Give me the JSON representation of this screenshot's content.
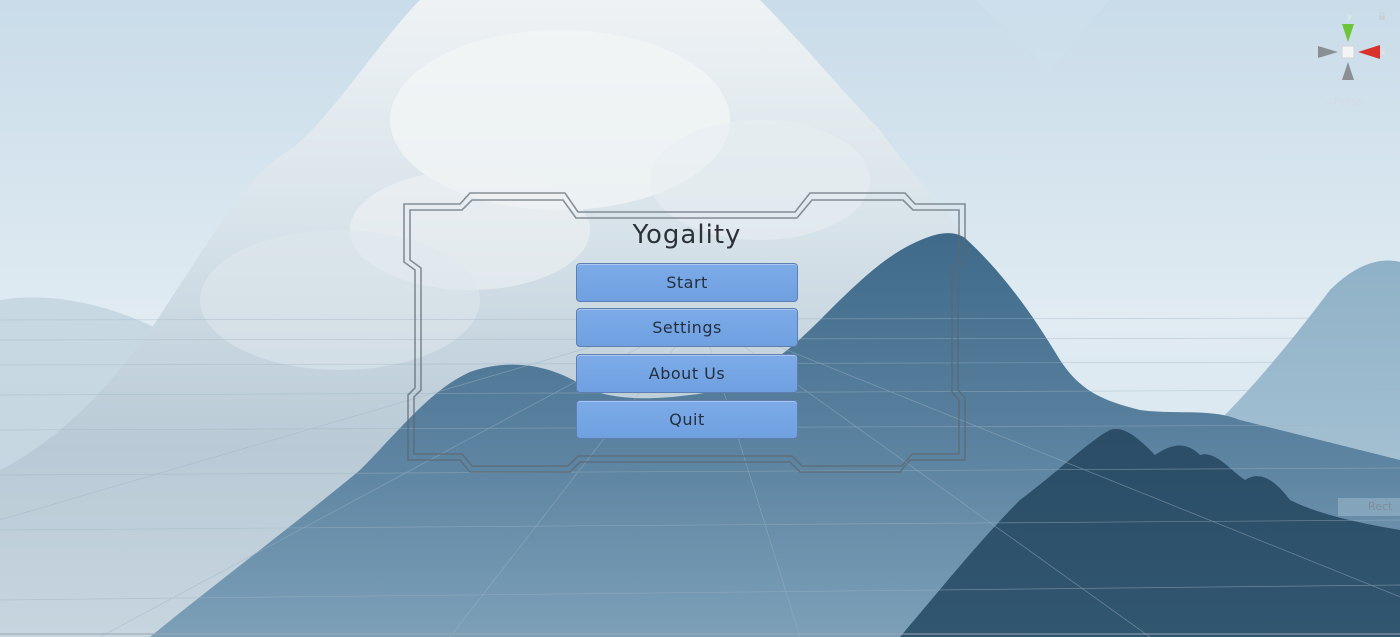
{
  "menu": {
    "title": "Yogality",
    "buttons": [
      {
        "label": "Start"
      },
      {
        "label": "Settings"
      },
      {
        "label": "About Us"
      },
      {
        "label": "Quit"
      }
    ]
  },
  "gizmo": {
    "y_axis_label": "y",
    "x_axis_label": "x",
    "projection_label": "Persp",
    "colors": {
      "y": "#6cc437",
      "x": "#d8322c",
      "neutral": "#8a8f94"
    }
  },
  "rect_tool": {
    "label": "Rect"
  },
  "colors": {
    "sky": "#dbe8f0",
    "mountain_dark": "#2f5674",
    "mountain_mid": "#466f8f",
    "snow": "#eef3f6",
    "button_fill": "#74a5e4",
    "button_border": "#5f7fb0"
  }
}
